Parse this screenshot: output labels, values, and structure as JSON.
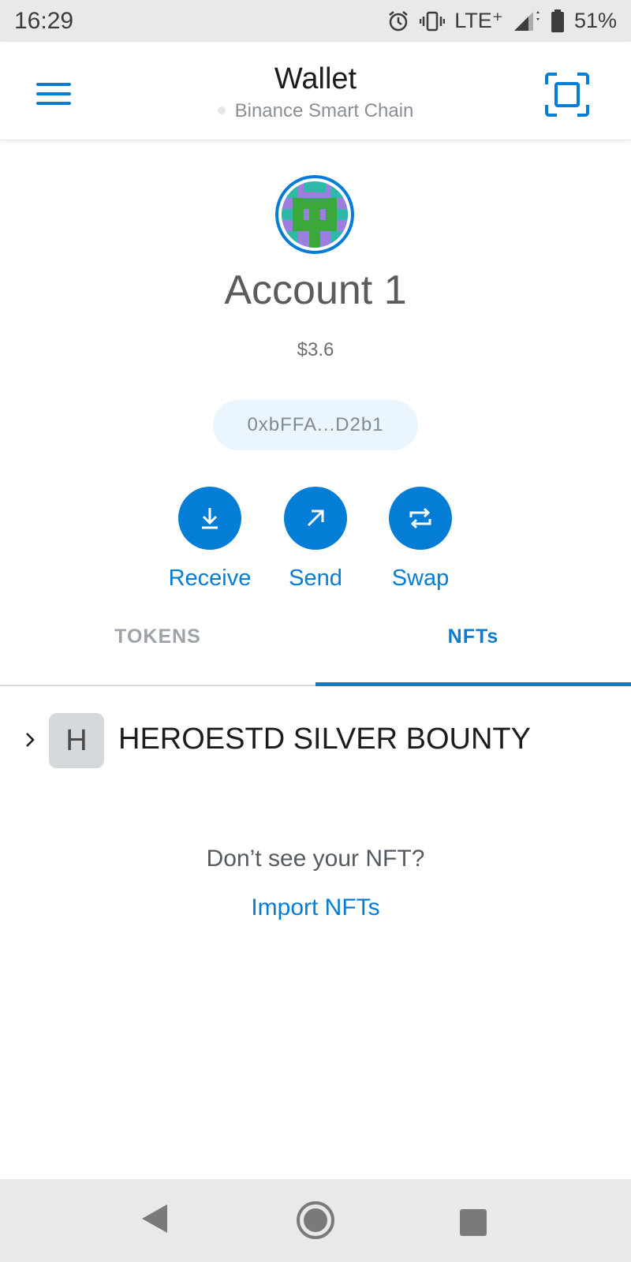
{
  "status_bar": {
    "time": "16:29",
    "network": "LTE⁺",
    "battery": "51%"
  },
  "header": {
    "title": "Wallet",
    "network_name": "Binance Smart Chain"
  },
  "account": {
    "name": "Account 1",
    "balance": "$3.6",
    "address": "0xbFFA...D2b1"
  },
  "actions": [
    {
      "label": "Receive",
      "icon": "download-icon"
    },
    {
      "label": "Send",
      "icon": "arrow-up-right-icon"
    },
    {
      "label": "Swap",
      "icon": "swap-icon"
    }
  ],
  "tabs": [
    {
      "label": "TOKENS",
      "active": false
    },
    {
      "label": "NFTs",
      "active": true
    }
  ],
  "nfts": {
    "collections": [
      {
        "badge": "H",
        "name": "HEROESTD SILVER BOUNTY"
      }
    ],
    "empty_prompt": "Don’t see your NFT?",
    "import_label": "Import NFTs"
  },
  "colors": {
    "accent": "#037dd6",
    "pill_bg": "#eaf5fd",
    "system_bar": "#e9e9ec"
  }
}
